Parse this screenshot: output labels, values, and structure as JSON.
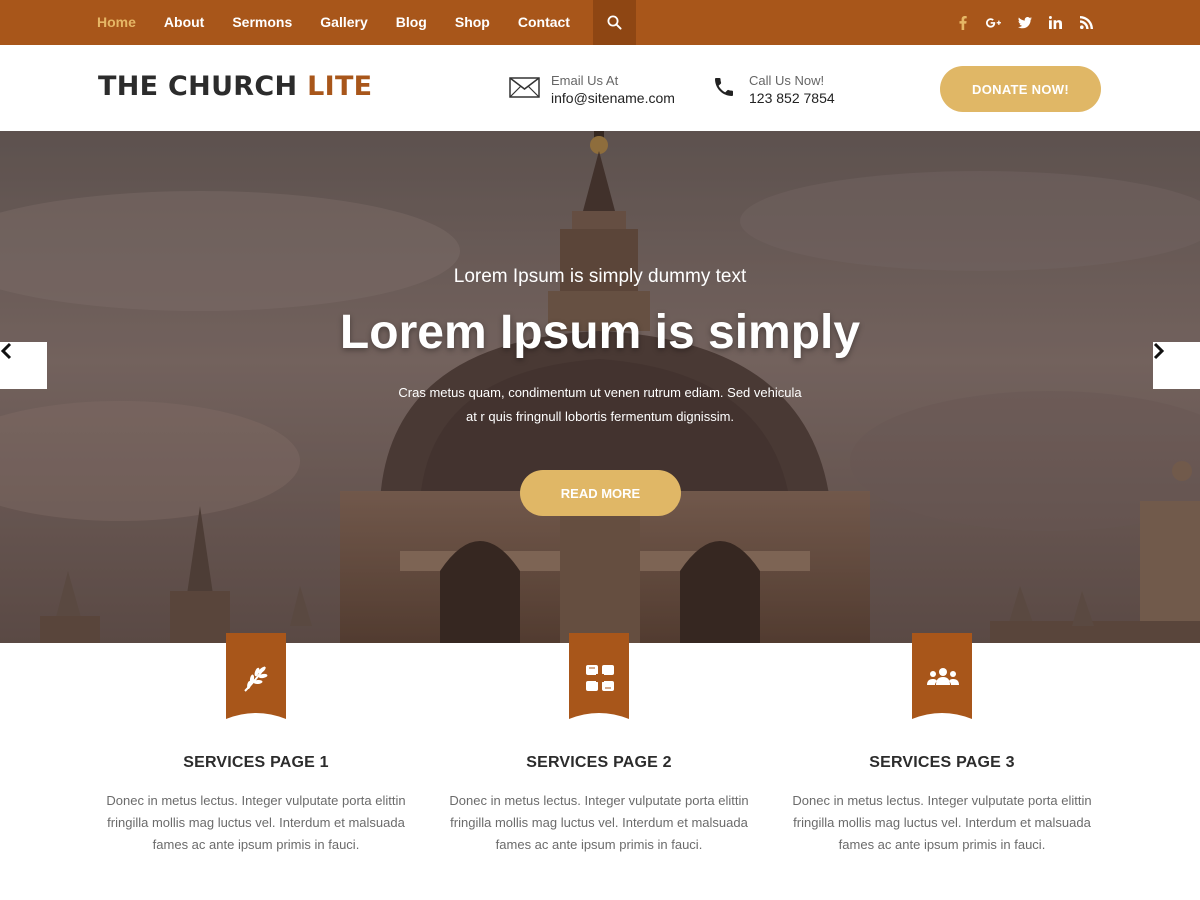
{
  "nav": {
    "items": [
      {
        "label": "Home"
      },
      {
        "label": "About"
      },
      {
        "label": "Sermons"
      },
      {
        "label": "Gallery"
      },
      {
        "label": "Blog"
      },
      {
        "label": "Shop"
      },
      {
        "label": "Contact"
      }
    ],
    "social": [
      {
        "name": "facebook-icon",
        "glyph": "f"
      },
      {
        "name": "google-plus-icon",
        "glyph": "g+"
      },
      {
        "name": "twitter-icon",
        "glyph": "t"
      },
      {
        "name": "linkedin-icon",
        "glyph": "in"
      },
      {
        "name": "rss-icon",
        "glyph": "rss"
      }
    ]
  },
  "header": {
    "logo_main": "THE CHURCH",
    "logo_accent": "LITE",
    "email_label": "Email Us At",
    "email_value": "info@sitename.com",
    "phone_label": "Call Us Now!",
    "phone_value": "123 852 7854",
    "donate_label": "DONATE NOW!"
  },
  "hero": {
    "subtitle": "Lorem Ipsum is simply dummy text",
    "title": "Lorem Ipsum is simply",
    "text_line1": "Cras metus quam, condimentum ut venen rutrum ediam. Sed vehicula",
    "text_line2": "at r quis fringnull lobortis fermentum dignissim.",
    "button_label": "READ MORE"
  },
  "services": [
    {
      "title": "SERVICES PAGE 1",
      "icon": "olive-branch-icon",
      "line1": "Donec in metus lectus. Integer vulputate porta elittin",
      "line2": "fringilla mollis mag luctus vel. Interdum et malsuada",
      "line3": "fames ac ante ipsum primis in fauci."
    },
    {
      "title": "SERVICES PAGE 2",
      "icon": "hands-together-icon",
      "line1": "Donec in metus lectus. Integer vulputate porta elittin",
      "line2": "fringilla mollis mag luctus vel. Interdum et malsuada",
      "line3": "fames ac ante ipsum primis in fauci."
    },
    {
      "title": "SERVICES PAGE 3",
      "icon": "users-group-icon",
      "line1": "Donec in metus lectus. Integer vulputate porta elittin",
      "line2": "fringilla mollis mag luctus vel. Interdum et malsuada",
      "line3": "fames ac ante ipsum primis in fauci."
    }
  ],
  "colors": {
    "brand": "#a8561a",
    "accent": "#e0b766",
    "active_nav": "#e6b766"
  }
}
